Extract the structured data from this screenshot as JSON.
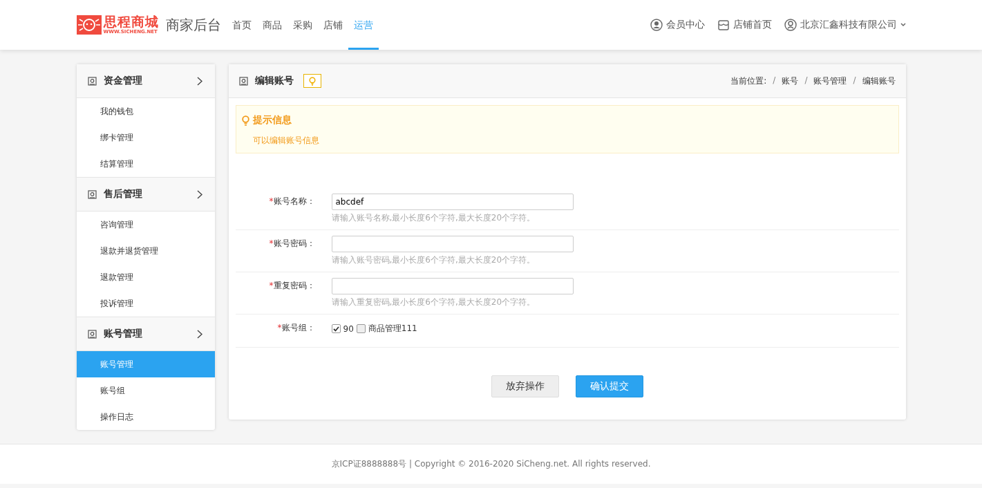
{
  "header": {
    "logo": {
      "name": "思程商城",
      "url": "WWW.SICHENG.NET"
    },
    "title": "商家后台",
    "nav": [
      {
        "label": "首页",
        "selected": false
      },
      {
        "label": "商品",
        "selected": false
      },
      {
        "label": "采购",
        "selected": false
      },
      {
        "label": "店铺",
        "selected": false
      },
      {
        "label": "运营",
        "selected": true
      }
    ],
    "links": [
      {
        "label": "会员中心",
        "kind": "member"
      },
      {
        "label": "店铺首页",
        "kind": "shop"
      },
      {
        "label": "北京汇鑫科技有限公司",
        "kind": "account"
      }
    ]
  },
  "sidebar": {
    "groups": [
      {
        "title": "资金管理",
        "items": [
          {
            "label": "我的钱包",
            "selected": false
          },
          {
            "label": "绑卡管理",
            "selected": false
          },
          {
            "label": "结算管理",
            "selected": false
          }
        ]
      },
      {
        "title": "售后管理",
        "items": [
          {
            "label": "咨询管理",
            "selected": false
          },
          {
            "label": "退款并退货管理",
            "selected": false
          },
          {
            "label": "退款管理",
            "selected": false
          },
          {
            "label": "投诉管理",
            "selected": false
          }
        ]
      },
      {
        "title": "账号管理",
        "items": [
          {
            "label": "账号管理",
            "selected": true
          },
          {
            "label": "账号组",
            "selected": false
          },
          {
            "label": "操作日志",
            "selected": false
          }
        ]
      }
    ]
  },
  "panel": {
    "title": "编辑账号",
    "breadcrumb": [
      {
        "text": "当前位置:",
        "kind": "label"
      },
      {
        "text": "/",
        "kind": "sep"
      },
      {
        "text": "账号",
        "kind": "link"
      },
      {
        "text": "/",
        "kind": "sep"
      },
      {
        "text": "账号管理",
        "kind": "link"
      },
      {
        "text": "/",
        "kind": "sep"
      },
      {
        "text": "编辑账号",
        "kind": "current"
      }
    ],
    "tip": {
      "title": "提示信息",
      "text": "可以编辑账号信息"
    },
    "form": [
      {
        "kind": "text",
        "mark": "*",
        "label": "账号名称：",
        "value": "abcdef",
        "hint": "请输入账号名称,最小长度6个字符,最大长度20个字符。"
      },
      {
        "kind": "password",
        "mark": "*",
        "label": "账号密码：",
        "hint": "请输入账号密码,最小长度6个字符,最大长度20个字符。"
      },
      {
        "kind": "password",
        "mark": "*",
        "label": "重复密码：",
        "hint": "请输入重复密码,最小长度6个字符,最大长度20个字符。"
      },
      {
        "kind": "checkboxes",
        "mark": "*",
        "label": "账号组：",
        "options": [
          {
            "label": "90",
            "checked": true
          },
          {
            "label": "商品管理111",
            "checked": false
          }
        ]
      }
    ],
    "buttons": [
      {
        "label": "放弃操作",
        "kind": "secondary"
      },
      {
        "label": "确认提交",
        "kind": "primary"
      }
    ]
  },
  "footer": "京ICP证8888888号 | Copyright © 2016-2020 SiCheng.net. All rights reserved."
}
